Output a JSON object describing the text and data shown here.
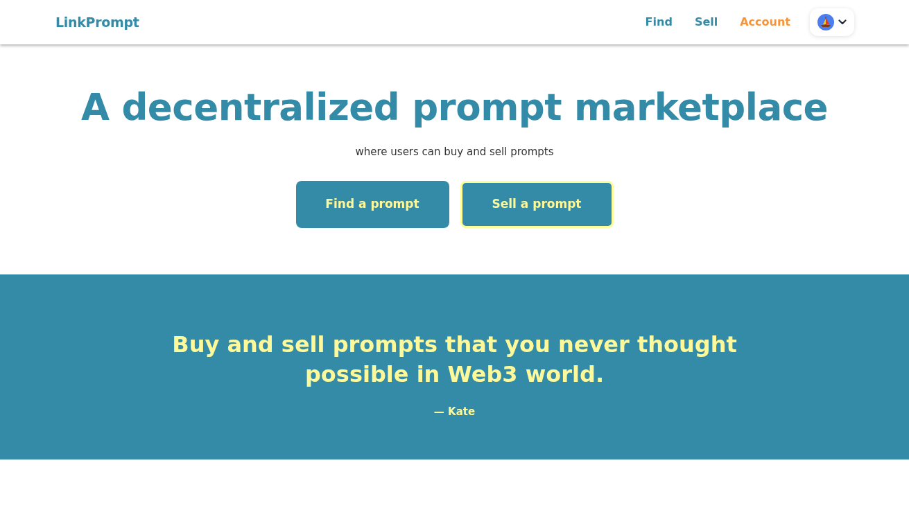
{
  "header": {
    "logo": "LinkPrompt",
    "nav": [
      {
        "label": "Find",
        "selected": false
      },
      {
        "label": "Sell",
        "selected": false
      },
      {
        "label": "Account",
        "selected": true
      }
    ]
  },
  "hero": {
    "title": "A decentralized prompt marketplace",
    "subtitle": "where users can buy and sell prompts",
    "buttons": [
      {
        "label": "Find a prompt",
        "focused": false
      },
      {
        "label": "Sell a prompt",
        "focused": true
      }
    ]
  },
  "quote": {
    "text": "Buy and sell prompts that you never thought possible in Web3 world.",
    "author": "— Kate"
  }
}
